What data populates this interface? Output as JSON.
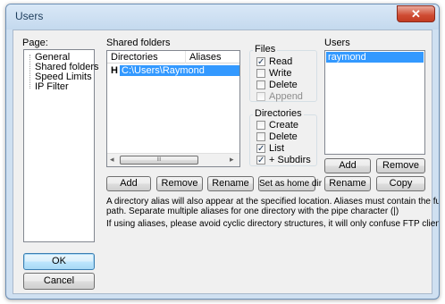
{
  "window": {
    "title": "Users",
    "close_glyph": "✕"
  },
  "page_panel": {
    "label": "Page:",
    "items": [
      "General",
      "Shared folders",
      "Speed Limits",
      "IP Filter"
    ]
  },
  "shared": {
    "label": "Shared folders",
    "columns": [
      "Directories",
      "Aliases"
    ],
    "rows": [
      {
        "marker": "H",
        "directory": "C:\\Users\\Raymond",
        "aliases": ""
      }
    ],
    "scroll": {
      "left": "◂",
      "thumb": "III",
      "right": "▸"
    },
    "buttons": [
      "Add",
      "Remove",
      "Rename",
      "Set as home dir"
    ]
  },
  "files": {
    "label": "Files",
    "items": [
      {
        "label": "Read",
        "checked": true,
        "disabled": false
      },
      {
        "label": "Write",
        "checked": false,
        "disabled": false
      },
      {
        "label": "Delete",
        "checked": false,
        "disabled": false
      },
      {
        "label": "Append",
        "checked": false,
        "disabled": true
      }
    ]
  },
  "directories": {
    "label": "Directories",
    "items": [
      {
        "label": "Create",
        "checked": false
      },
      {
        "label": "Delete",
        "checked": false
      },
      {
        "label": "List",
        "checked": true
      },
      {
        "label": "+ Subdirs",
        "checked": true
      }
    ]
  },
  "users": {
    "label": "Users",
    "list": [
      "raymond"
    ],
    "buttons": [
      "Add",
      "Remove",
      "Rename",
      "Copy"
    ]
  },
  "info": {
    "line1": "A directory alias will also appear at the specified location. Aliases must contain the full local",
    "line2": "path. Separate multiple aliases for one directory with the pipe character (|)",
    "line3": "If using aliases, please avoid cyclic directory structures, it will only confuse FTP clients."
  },
  "footer": {
    "ok": "OK",
    "cancel": "Cancel"
  },
  "check_glyph": "✓"
}
